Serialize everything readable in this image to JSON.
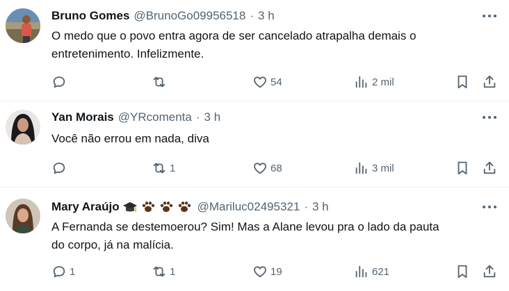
{
  "tweets": [
    {
      "name": "Bruno Gomes",
      "handle": "@BrunoGo09956518",
      "dot": "·",
      "time": "3 h",
      "text_lines": [
        "O medo que o povo entra agora de ser cancelado atrapalha demais o",
        "entretenimento. Infelizmente."
      ],
      "reply_count": "",
      "retweet_count": "",
      "like_count": "54",
      "view_count": "2 mil"
    },
    {
      "name": "Yan Morais",
      "handle": "@YRcomenta",
      "dot": "·",
      "time": "3 h",
      "text_lines": [
        "Você não errou em nada, diva"
      ],
      "reply_count": "",
      "retweet_count": "1",
      "like_count": "68",
      "view_count": "3 mil"
    },
    {
      "name": "Mary Araújo",
      "handle": "@Mariluc02495321",
      "dot": "·",
      "time": "3 h",
      "emojis": [
        "graduation-cap-emoji",
        "paw-emoji",
        "paw-emoji",
        "paw-emoji"
      ],
      "text_lines": [
        "A Fernanda se destemoerou? Sim! Mas a Alane levou pra o lado da pauta",
        "do corpo, já na malícia."
      ],
      "reply_count": "1",
      "retweet_count": "1",
      "like_count": "19",
      "view_count": "621"
    }
  ],
  "colors": {
    "text_primary": "#0f1419",
    "text_secondary": "#536471",
    "divider": "#eff3f4"
  },
  "icons": [
    "reply-icon",
    "retweet-icon",
    "like-icon",
    "views-icon",
    "bookmark-icon",
    "share-icon",
    "more-icon"
  ]
}
